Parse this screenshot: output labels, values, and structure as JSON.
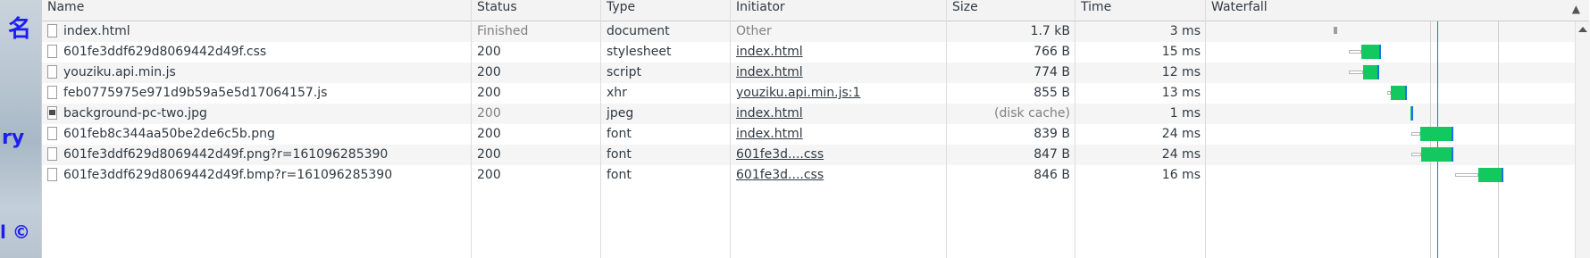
{
  "page_fragments": [
    "名",
    "ry",
    "l ©"
  ],
  "columns": {
    "name": "Name",
    "status": "Status",
    "type": "Type",
    "initiator": "Initiator",
    "size": "Size",
    "time": "Time",
    "waterfall": "Waterfall"
  },
  "rows": [
    {
      "name": "index.html",
      "status": "Finished",
      "type": "document",
      "initiator": "Other",
      "size": "1.7 kB",
      "time": "3 ms",
      "icon": "document-icon"
    },
    {
      "name": "601fe3ddf629d8069442d49f.css",
      "status": "200",
      "type": "stylesheet",
      "initiator": "index.html",
      "size": "766 B",
      "time": "15 ms",
      "icon": "document-icon"
    },
    {
      "name": "youziku.api.min.js",
      "status": "200",
      "type": "script",
      "initiator": "index.html",
      "size": "774 B",
      "time": "12 ms",
      "icon": "document-icon"
    },
    {
      "name": "feb0775975e971d9b59a5e5d17064157.js",
      "status": "200",
      "type": "xhr",
      "initiator": "youziku.api.min.js:1",
      "size": "855 B",
      "time": "13 ms",
      "icon": "document-icon"
    },
    {
      "name": "background-pc-two.jpg",
      "status": "200",
      "type": "jpeg",
      "initiator": "index.html",
      "size": "(disk cache)",
      "time": "1 ms",
      "icon": "image-icon"
    },
    {
      "name": "601feb8c344aa50be2de6c5b.png",
      "status": "200",
      "type": "font",
      "initiator": "index.html",
      "size": "839 B",
      "time": "24 ms",
      "icon": "document-icon"
    },
    {
      "name": "601fe3ddf629d8069442d49f.png?r=161096285390",
      "status": "200",
      "type": "font",
      "initiator": "601fe3d....css",
      "size": "847 B",
      "time": "24 ms",
      "icon": "document-icon"
    },
    {
      "name": "601fe3ddf629d8069442d49f.bmp?r=161096285390",
      "status": "200",
      "type": "font",
      "initiator": "601fe3d....css",
      "size": "846 B",
      "time": "16 ms",
      "icon": "document-icon"
    }
  ],
  "colors": {
    "download": "#13c85e",
    "dom_content_loaded": "#1a73e8",
    "load": "#e53935",
    "link_blue": "#1d1df2"
  }
}
